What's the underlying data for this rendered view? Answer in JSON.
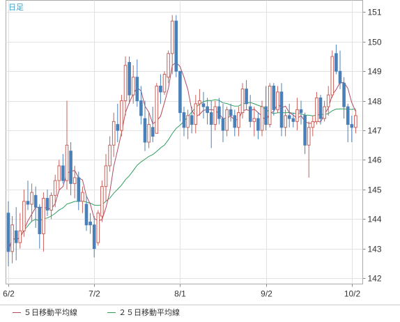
{
  "chart_data": {
    "type": "candlestick",
    "timeframe_label": "日足",
    "ylim": [
      141.8,
      151.4
    ],
    "yticks": [
      142,
      143,
      144,
      145,
      146,
      147,
      148,
      149,
      150,
      151
    ],
    "xticks": [
      {
        "index": 0,
        "label": "6/2"
      },
      {
        "index": 22,
        "label": "7/2"
      },
      {
        "index": 44,
        "label": "8/1"
      },
      {
        "index": 66,
        "label": "9/2"
      },
      {
        "index": 88,
        "label": "10/2"
      }
    ],
    "grid": true,
    "colors": {
      "up": "#c8605a",
      "down": "#4a80b8",
      "ma5": "#b04a60",
      "ma25": "#2e9e5e"
    },
    "legend": [
      {
        "key": "ma5",
        "label": "５日移動平均線"
      },
      {
        "key": "ma25",
        "label": "２５日移動平均線"
      }
    ],
    "candles": [
      [
        144.2,
        144.6,
        142.4,
        142.9
      ],
      [
        142.9,
        144.1,
        142.5,
        143.8
      ],
      [
        143.6,
        144.4,
        142.6,
        143.2
      ],
      [
        143.2,
        144.2,
        143.0,
        143.6
      ],
      [
        143.6,
        145.0,
        143.4,
        144.6
      ],
      [
        144.6,
        145.3,
        144.3,
        144.5
      ],
      [
        144.5,
        145.2,
        143.9,
        144.9
      ],
      [
        144.8,
        145.1,
        143.7,
        144.4
      ],
      [
        144.4,
        144.5,
        143.0,
        143.5
      ],
      [
        143.5,
        144.9,
        142.9,
        144.7
      ],
      [
        144.7,
        145.0,
        144.1,
        144.3
      ],
      [
        144.3,
        144.9,
        144.0,
        144.8
      ],
      [
        144.8,
        145.5,
        144.4,
        145.3
      ],
      [
        145.3,
        146.0,
        145.0,
        145.8
      ],
      [
        145.8,
        146.2,
        145.2,
        145.3
      ],
      [
        145.3,
        148.0,
        145.0,
        146.5
      ],
      [
        146.3,
        146.6,
        144.8,
        145.2
      ],
      [
        145.2,
        145.8,
        144.7,
        145.4
      ],
      [
        145.4,
        145.6,
        144.3,
        144.6
      ],
      [
        144.6,
        145.1,
        144.2,
        144.9
      ],
      [
        144.5,
        144.8,
        143.6,
        143.8
      ],
      [
        143.9,
        144.2,
        143.5,
        143.8
      ],
      [
        143.8,
        144.1,
        142.7,
        143.0
      ],
      [
        143.2,
        144.3,
        143.1,
        144.2
      ],
      [
        144.1,
        145.3,
        143.9,
        145.1
      ],
      [
        145.1,
        146.2,
        144.6,
        145.8
      ],
      [
        145.8,
        146.8,
        145.6,
        146.5
      ],
      [
        146.5,
        147.6,
        146.1,
        147.3
      ],
      [
        147.2,
        147.9,
        146.6,
        147.0
      ],
      [
        147.0,
        148.2,
        146.8,
        148.0
      ],
      [
        148.0,
        149.5,
        147.5,
        149.2
      ],
      [
        149.3,
        149.5,
        147.9,
        148.2
      ],
      [
        148.2,
        149.2,
        147.9,
        148.8
      ],
      [
        148.8,
        149.4,
        147.8,
        148.0
      ],
      [
        148.0,
        148.5,
        147.2,
        147.5
      ],
      [
        147.4,
        148.0,
        146.3,
        146.6
      ],
      [
        146.6,
        147.6,
        146.4,
        147.2
      ],
      [
        147.1,
        147.8,
        146.6,
        146.8
      ],
      [
        146.9,
        148.6,
        146.9,
        148.5
      ],
      [
        148.5,
        148.9,
        147.9,
        148.3
      ],
      [
        148.3,
        149.0,
        148.2,
        148.9
      ],
      [
        148.8,
        149.7,
        148.6,
        149.6
      ],
      [
        149.6,
        150.9,
        148.9,
        150.7
      ],
      [
        150.7,
        150.9,
        148.8,
        149.0
      ],
      [
        149.0,
        149.0,
        147.3,
        147.6
      ],
      [
        147.6,
        147.8,
        146.8,
        147.1
      ],
      [
        147.1,
        147.7,
        146.7,
        147.5
      ],
      [
        147.5,
        147.8,
        146.9,
        147.2
      ],
      [
        147.2,
        148.2,
        146.9,
        147.9
      ],
      [
        147.9,
        148.4,
        147.5,
        148.0
      ],
      [
        147.9,
        148.3,
        147.4,
        147.8
      ],
      [
        147.8,
        148.1,
        147.2,
        147.6
      ],
      [
        147.6,
        148.0,
        146.4,
        147.2
      ],
      [
        147.2,
        148.0,
        147.0,
        147.8
      ],
      [
        147.8,
        148.1,
        147.2,
        147.4
      ],
      [
        147.4,
        147.9,
        146.6,
        147.0
      ],
      [
        147.0,
        147.8,
        146.8,
        147.7
      ],
      [
        147.7,
        147.9,
        147.3,
        147.5
      ],
      [
        147.5,
        147.7,
        146.8,
        147.1
      ],
      [
        147.1,
        147.8,
        146.8,
        147.6
      ],
      [
        147.6,
        148.6,
        147.4,
        148.4
      ],
      [
        148.4,
        148.7,
        147.7,
        147.9
      ],
      [
        147.8,
        148.2,
        147.1,
        147.3
      ],
      [
        147.3,
        147.8,
        146.8,
        147.4
      ],
      [
        147.4,
        147.6,
        146.7,
        147.0
      ],
      [
        147.0,
        148.0,
        146.8,
        147.8
      ],
      [
        147.8,
        148.5,
        147.0,
        147.2
      ],
      [
        147.2,
        148.6,
        147.1,
        148.5
      ],
      [
        148.5,
        148.6,
        147.5,
        147.7
      ],
      [
        147.7,
        148.5,
        147.6,
        148.3
      ],
      [
        148.3,
        148.6,
        146.8,
        147.1
      ],
      [
        147.1,
        147.7,
        146.8,
        147.5
      ],
      [
        147.5,
        147.9,
        147.1,
        147.4
      ],
      [
        147.4,
        147.6,
        147.1,
        147.3
      ],
      [
        147.3,
        148.1,
        147.0,
        147.7
      ],
      [
        147.7,
        148.0,
        147.2,
        147.6
      ],
      [
        147.5,
        147.6,
        146.2,
        146.5
      ],
      [
        146.5,
        147.3,
        145.4,
        147.1
      ],
      [
        147.1,
        147.5,
        146.8,
        147.3
      ],
      [
        147.3,
        148.3,
        147.2,
        148.1
      ],
      [
        148.1,
        148.2,
        147.2,
        147.4
      ],
      [
        147.4,
        148.0,
        147.3,
        147.8
      ],
      [
        147.8,
        148.5,
        147.5,
        148.2
      ],
      [
        148.2,
        149.7,
        148.1,
        149.5
      ],
      [
        149.6,
        149.9,
        148.9,
        149.0
      ],
      [
        149.0,
        149.7,
        148.4,
        148.6
      ],
      [
        148.6,
        148.8,
        147.4,
        147.8
      ],
      [
        147.8,
        147.9,
        146.6,
        147.2
      ],
      [
        147.2,
        147.5,
        146.6,
        147.1
      ],
      [
        147.1,
        147.7,
        146.9,
        147.5
      ]
    ]
  }
}
